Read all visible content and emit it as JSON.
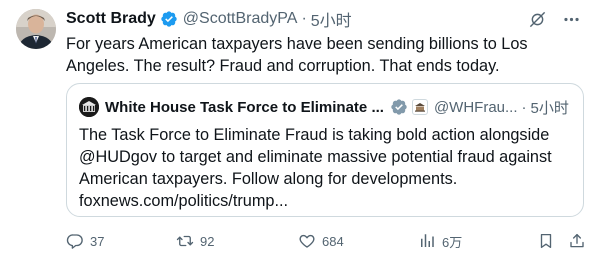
{
  "tweet": {
    "author_name": "Scott Brady",
    "handle": "@ScottBradyPA",
    "separator": "·",
    "time": "5小时",
    "text": "For years American taxpayers have been sending billions to Los Angeles. The result? Fraud and corruption. That ends today."
  },
  "quote": {
    "author_name": "White House Task Force to Eliminate ...",
    "handle": "@WHFrau...",
    "separator": "·",
    "time": "5小时",
    "text": "The Task Force to Eliminate Fraud is taking bold action alongside @HUDgov to target and eliminate massive potential fraud against American taxpayers. Follow along for developments. foxnews.com/politics/trump..."
  },
  "actions": {
    "replies": "37",
    "retweets": "92",
    "likes": "684",
    "views": "6万"
  },
  "colors": {
    "verified_blue": "#1d9bf0",
    "verified_gray": "#829aab",
    "muted_text": "#536471",
    "border": "#cfd9de"
  },
  "icons": {
    "grok": "grok-icon",
    "more": "more-icon",
    "reply": "reply-icon",
    "retweet": "retweet-icon",
    "like": "heart-icon",
    "views": "views-icon",
    "bookmark": "bookmark-icon",
    "share": "share-icon"
  }
}
